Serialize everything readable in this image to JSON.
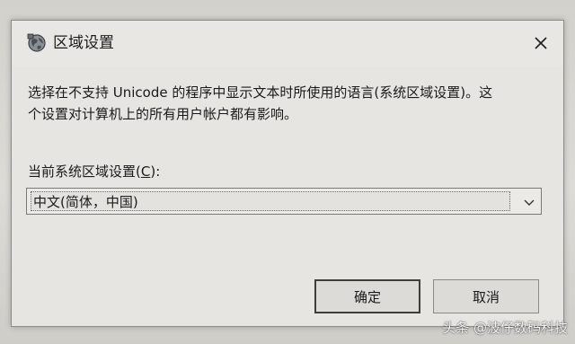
{
  "window": {
    "title": "区域设置",
    "icon": "globe-icon",
    "close_icon": "close-icon"
  },
  "description": {
    "line1": "选择在不支持 Unicode 的程序中显示文本时所使用的语言(系统区域设置)。这",
    "line2": "个设置对计算机上的所有用户帐户都有影响。"
  },
  "locale_field": {
    "label_prefix": "当前系统区域设置(",
    "label_accel": "C",
    "label_suffix": "):",
    "selected_value": "中文(简体，中国)",
    "dropdown_icon": "chevron-down-icon"
  },
  "buttons": {
    "ok_label": "确定",
    "cancel_label": "取消"
  },
  "watermark": {
    "text": "头条 @波仔数码科技"
  },
  "colors": {
    "dialog_bg": "#e6e5e1",
    "text": "#1a1a1a",
    "default_button_border": "#3e3d3a"
  }
}
